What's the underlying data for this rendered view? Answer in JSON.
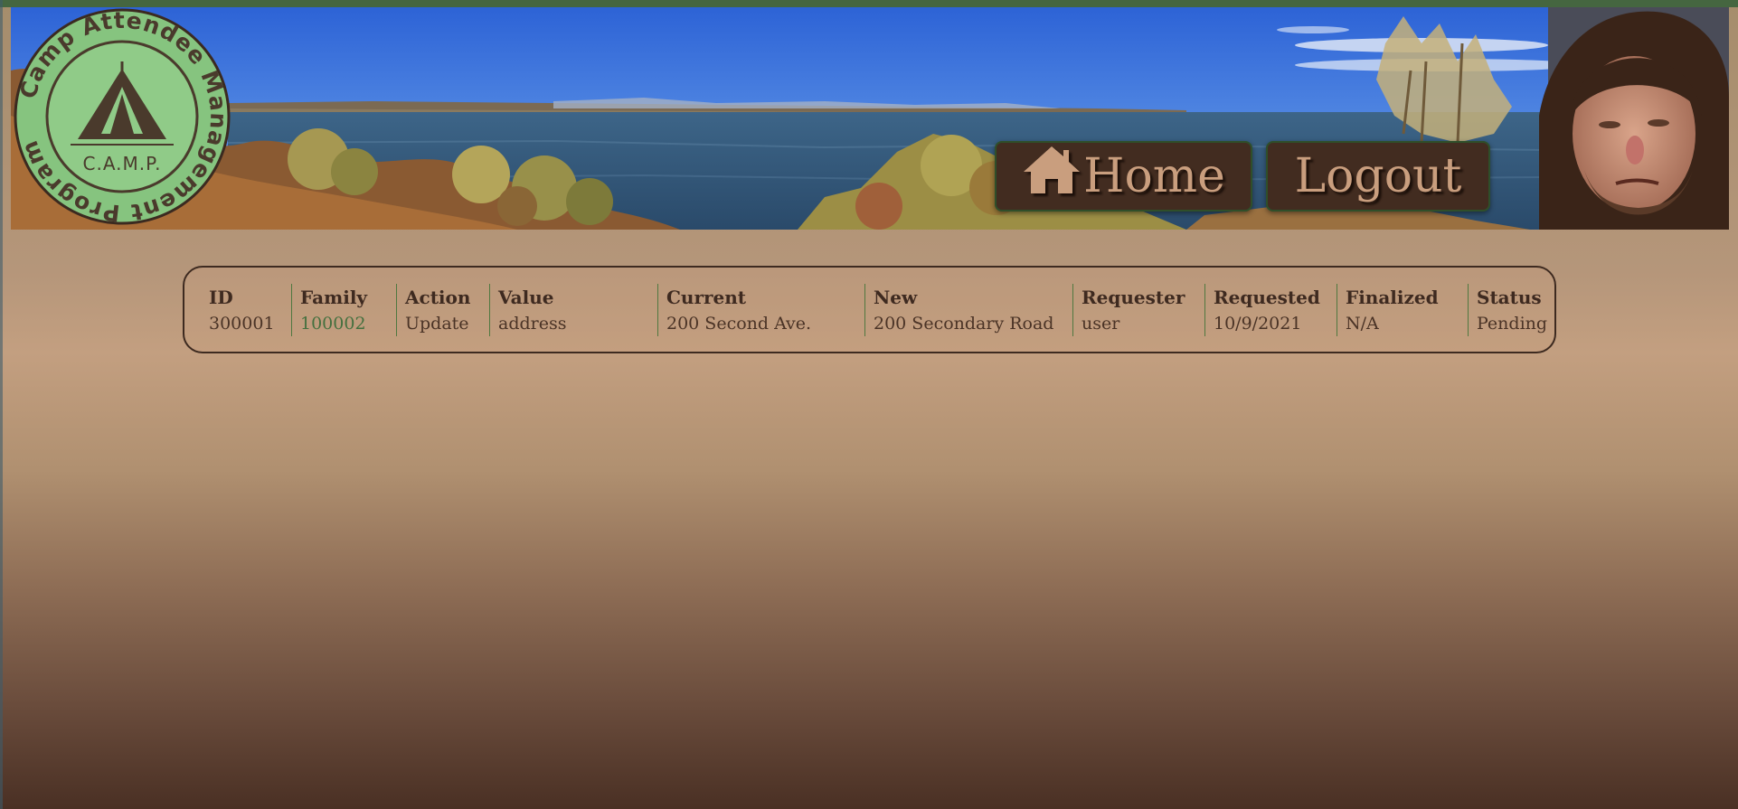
{
  "logo": {
    "ring_text_top": "Camp Attendee Management Program",
    "abbreviation": "C.A.M.P."
  },
  "nav": {
    "home_label": "Home",
    "logout_label": "Logout"
  },
  "icons": {
    "home": "house-icon"
  },
  "colors": {
    "accent_green": "#456640",
    "button_bg": "#422c20",
    "button_text": "#c99e7e",
    "link_green": "#44703f",
    "logo_green": "#86c47f"
  },
  "table": {
    "headers": {
      "id": "ID",
      "family": "Family",
      "action": "Action",
      "value": "Value",
      "current": "Current",
      "new": "New",
      "requester": "Requester",
      "requested": "Requested",
      "finalized": "Finalized",
      "status": "Status"
    },
    "rows": [
      {
        "id": "300001",
        "family": "100002",
        "action": "Update",
        "value": "address",
        "current": "200 Second Ave.",
        "new": "200 Secondary Road",
        "requester": "user",
        "requested": "10/9/2021",
        "finalized": "N/A",
        "status": "Pending"
      }
    ]
  }
}
